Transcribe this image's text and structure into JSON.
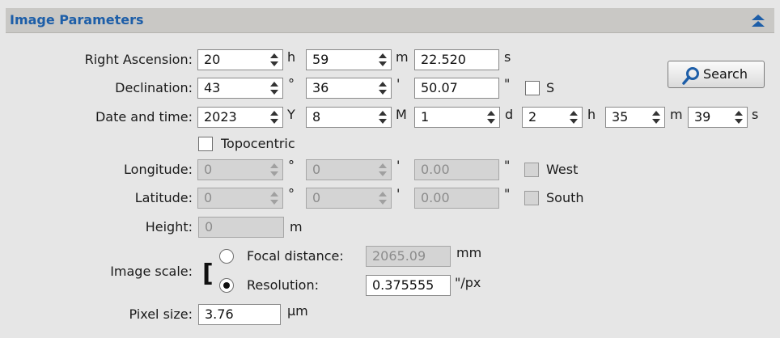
{
  "panel": {
    "title": "Image Parameters"
  },
  "labels": {
    "right_ascension": "Right Ascension:",
    "declination": "Declination:",
    "date_time": "Date and time:",
    "topocentric": "Topocentric",
    "longitude": "Longitude:",
    "latitude": "Latitude:",
    "height": "Height:",
    "image_scale": "Image scale:",
    "focal_distance": "Focal distance:",
    "resolution": "Resolution:",
    "pixel_size": "Pixel size:"
  },
  "ra": {
    "h": "20",
    "m": "59",
    "s": "22.520",
    "unit_h": "h",
    "unit_m": "m",
    "unit_s": "s"
  },
  "dec": {
    "deg": "43",
    "min": "36",
    "sec": "50.07",
    "unit_deg": "°",
    "unit_min": "'",
    "unit_sec": "\"",
    "south_label": "S",
    "south_checked": false
  },
  "datetime": {
    "year": "2023",
    "month": "8",
    "day": "1",
    "hour": "2",
    "minute": "35",
    "second": "39",
    "unit_y": "Y",
    "unit_mo": "M",
    "unit_d": "d",
    "unit_h": "h",
    "unit_mi": "m",
    "unit_s": "s"
  },
  "topocentric_checked": false,
  "longitude": {
    "deg": "0",
    "min": "0",
    "sec": "0.00",
    "unit_deg": "°",
    "unit_min": "'",
    "unit_sec": "\"",
    "west_label": "West"
  },
  "latitude": {
    "deg": "0",
    "min": "0",
    "sec": "0.00",
    "unit_deg": "°",
    "unit_min": "'",
    "unit_sec": "\"",
    "south_label": "South"
  },
  "height": {
    "value": "0",
    "unit": "m"
  },
  "scale": {
    "bracket": "[",
    "focal_value": "2065.09",
    "focal_unit": "mm",
    "resolution_value": "0.375555",
    "resolution_unit": "\"/px",
    "selected": "resolution"
  },
  "pixel_size": {
    "value": "3.76",
    "unit": "µm"
  },
  "search": {
    "label": "Search"
  },
  "colors": {
    "title": "#1d5ea8",
    "header_bg": "#c9c8c5",
    "bg": "#e6e6e6"
  }
}
